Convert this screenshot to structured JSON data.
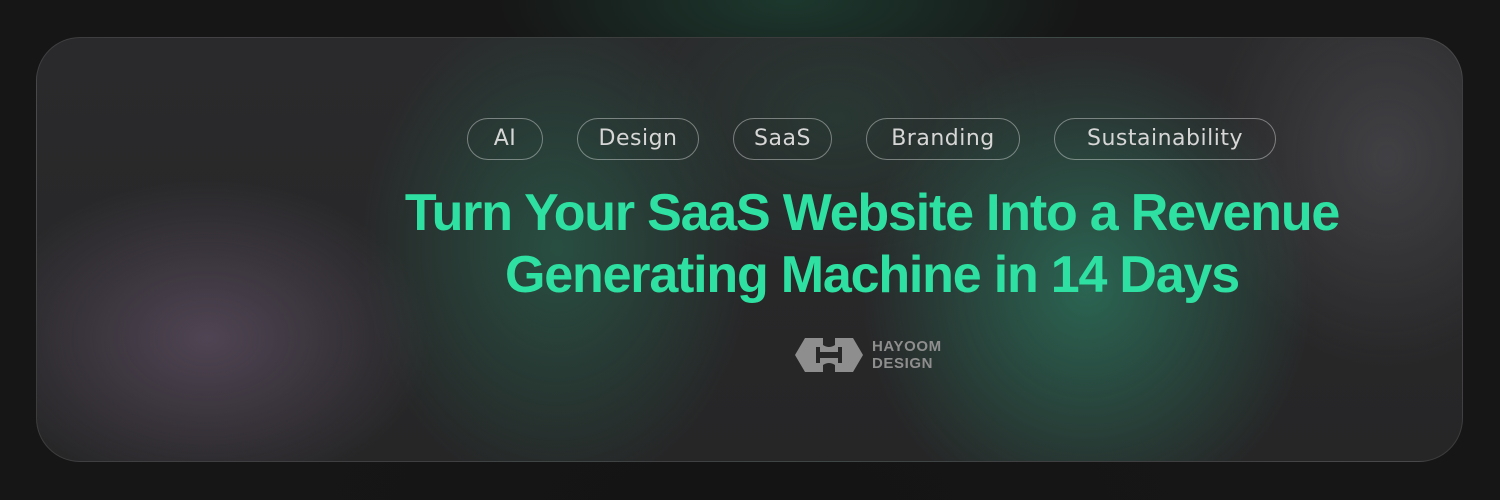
{
  "tags": [
    "AI",
    "Design",
    "SaaS",
    "Branding",
    "Sustainability"
  ],
  "headline": {
    "line1": "Turn Your SaaS Website Into a Revenue",
    "line2": "Generating Machine in 14 Days"
  },
  "brand": {
    "line1": "HAYOOM",
    "line2": "DESIGN",
    "logo_icon": "hayoom-h-logo-icon"
  },
  "colors": {
    "accent": "#2ee0a1",
    "tag_text": "#d6d6d6",
    "brand_gray": "#8e8e8e"
  }
}
